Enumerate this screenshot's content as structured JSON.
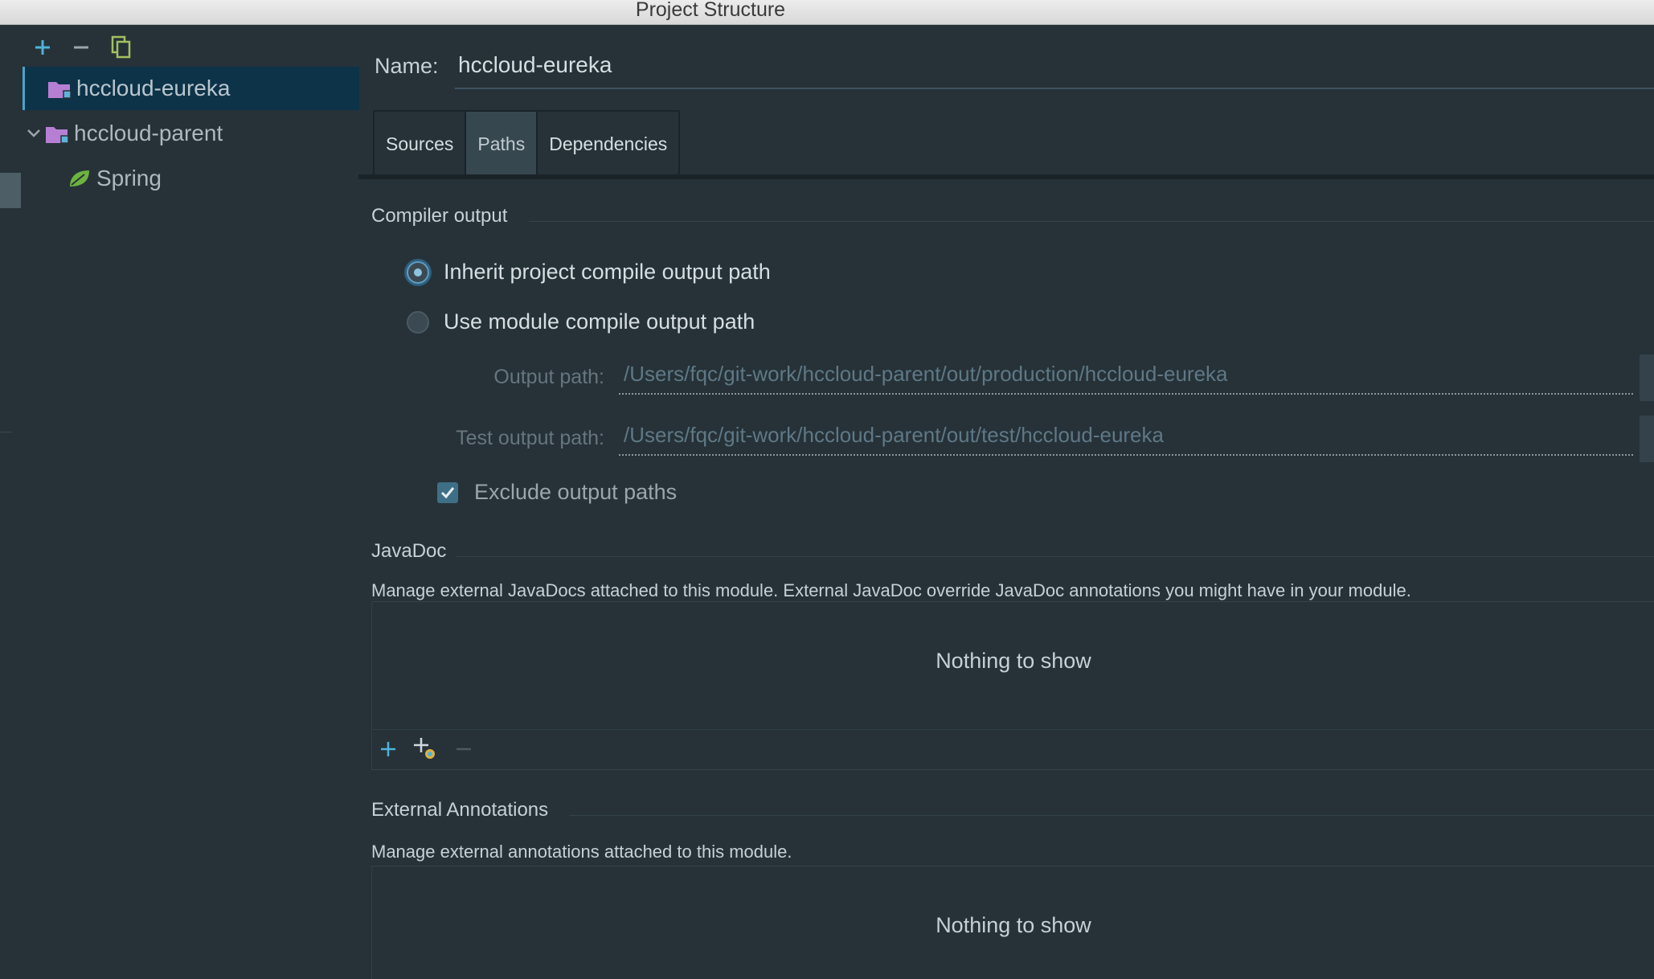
{
  "window": {
    "title": "Project Structure"
  },
  "left": {
    "toolbar": [
      "add-icon",
      "remove-icon",
      "copy-icon"
    ],
    "tree": [
      {
        "label": "hccloud-eureka",
        "icon": "module-folder-icon",
        "selected": true
      },
      {
        "label": "hccloud-parent",
        "icon": "module-folder-icon",
        "expanded": true
      },
      {
        "label": "Spring",
        "icon": "spring-leaf-icon"
      }
    ]
  },
  "module": {
    "name_label": "Name:",
    "name_value": "hccloud-eureka",
    "tabs": [
      {
        "label": "Sources"
      },
      {
        "label": "Paths",
        "active": true
      },
      {
        "label": "Dependencies"
      }
    ]
  },
  "compiler_output": {
    "title": "Compiler output",
    "inherit_label": "Inherit project compile output path",
    "use_module_label": "Use module compile output path",
    "selected": "inherit",
    "output_path_label": "Output path:",
    "output_path_value": "/Users/fqc/git-work/hccloud-parent/out/production/hccloud-eureka",
    "test_output_path_label": "Test output path:",
    "test_output_path_value": "/Users/fqc/git-work/hccloud-parent/out/test/hccloud-eureka",
    "exclude_label": "Exclude output paths",
    "exclude_checked": true
  },
  "javadoc": {
    "title": "JavaDoc",
    "description": "Manage external JavaDocs attached to this module. External JavaDoc override JavaDoc annotations you might have in your module.",
    "empty_text": "Nothing to show",
    "toolbar": [
      "add-icon",
      "add-url-icon",
      "remove-icon"
    ]
  },
  "external_annotations": {
    "title": "External Annotations",
    "description": "Manage external annotations attached to this module.",
    "empty_text": "Nothing to show"
  },
  "colors": {
    "background": "#263238",
    "selection": "#0d3349",
    "accent": "#4aa3c9"
  }
}
